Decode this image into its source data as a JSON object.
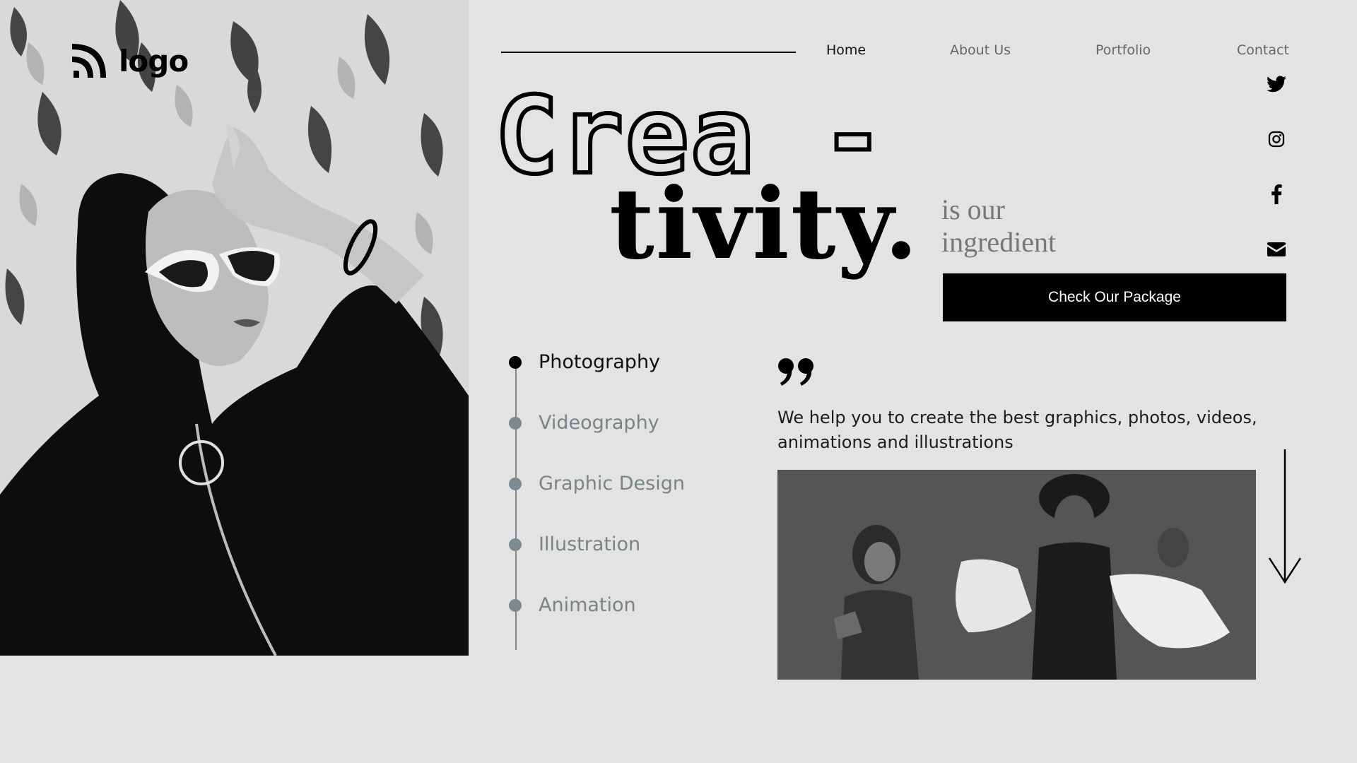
{
  "logo": {
    "text": "logo",
    "icon": "wifi-waves-logo-icon"
  },
  "nav": {
    "items": [
      {
        "label": "Home",
        "active": true
      },
      {
        "label": "About Us",
        "active": false
      },
      {
        "label": "Portfolio",
        "active": false
      },
      {
        "label": "Contact",
        "active": false
      }
    ]
  },
  "social": [
    "twitter-icon",
    "instagram-icon",
    "facebook-icon",
    "mail-icon"
  ],
  "headline": {
    "line1": "Crea -",
    "line2": "tivity.",
    "tagline": "is our ingredient"
  },
  "cta": {
    "label": "Check Our Package"
  },
  "services": [
    {
      "label": "Photography",
      "active": true
    },
    {
      "label": "Videography",
      "active": false
    },
    {
      "label": "Graphic Design",
      "active": false
    },
    {
      "label": "Illustration",
      "active": false
    },
    {
      "label": "Animation",
      "active": false
    }
  ],
  "blurb": "We help you to create the best graphics, photos, videos, animations and illustrations",
  "colors": {
    "background": "#e3e3e3",
    "accent": "#000000",
    "muted": "#7a8385"
  }
}
